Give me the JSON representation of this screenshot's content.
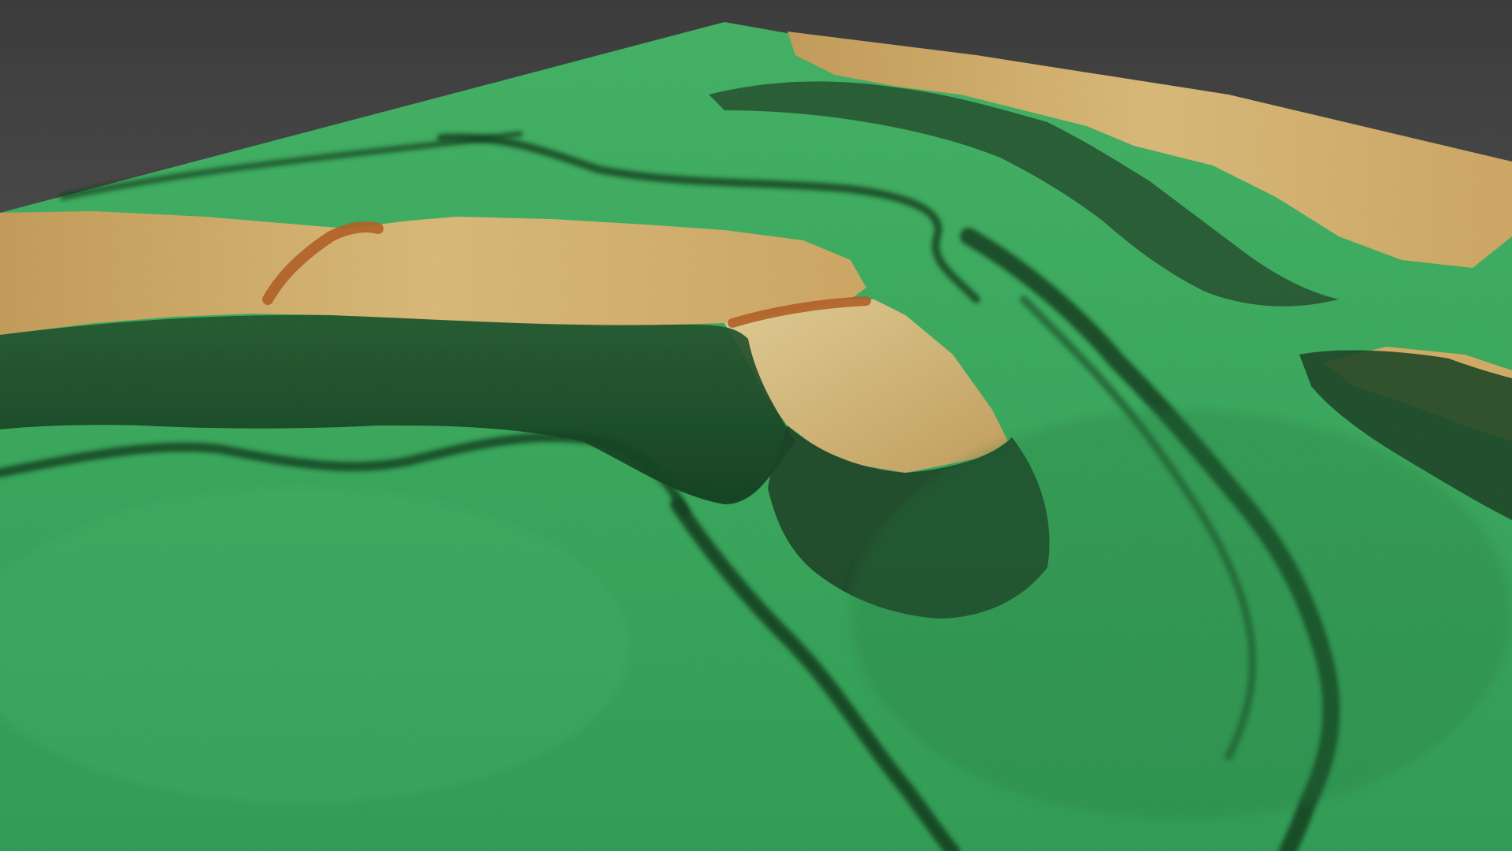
{
  "scene": {
    "subject": "",
    "colors": {
      "background_top": "#3c3c3c",
      "background_bottom": "#6a6a6a",
      "lowland_green": "#3fae62",
      "lowland_green_light": "#5cc97a",
      "slope_dark": "#1f4a2a",
      "plateau_tan": "#d9b46e",
      "plateau_light": "#e6cf93",
      "cliff_edge_orange": "#b8652a"
    }
  }
}
